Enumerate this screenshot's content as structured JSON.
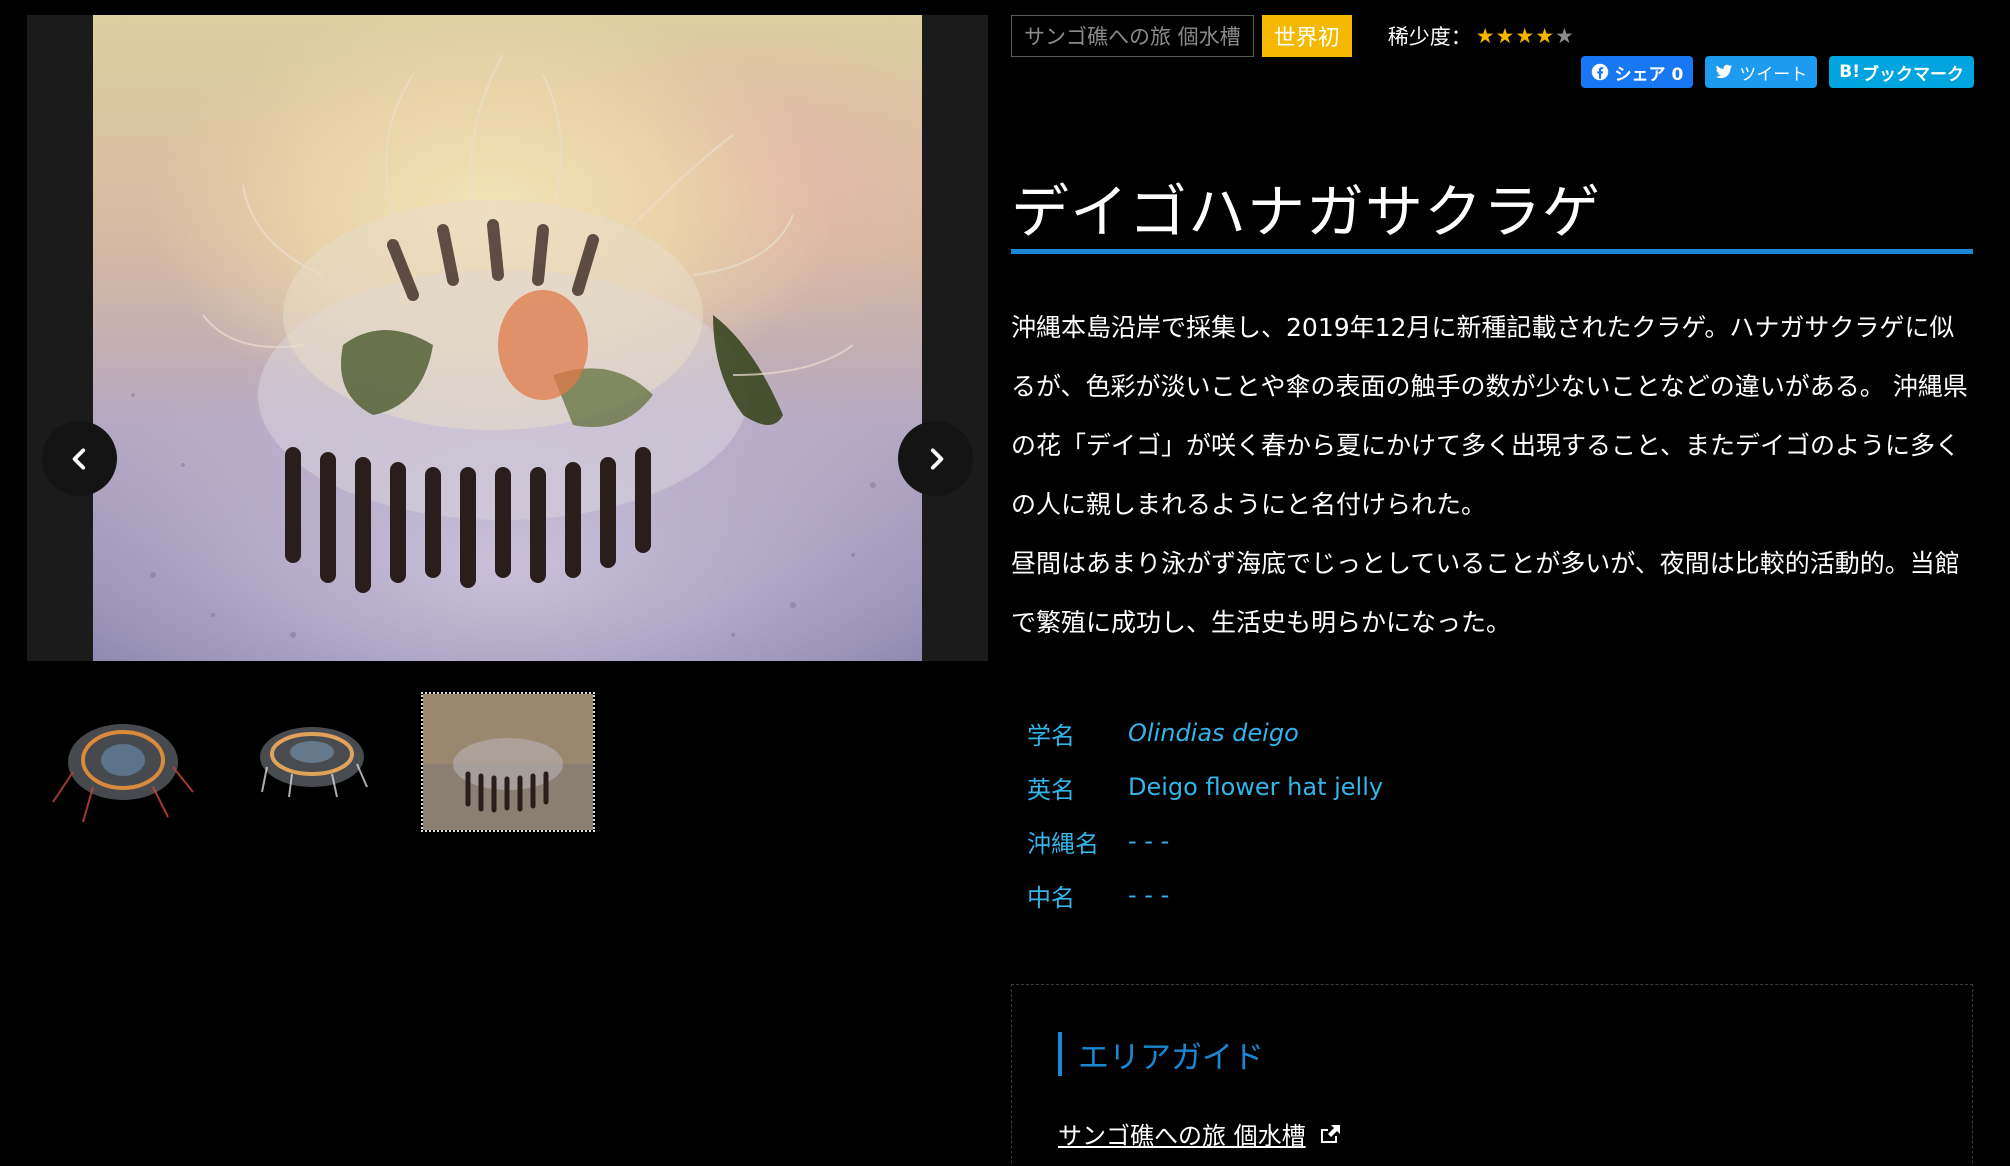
{
  "gallery": {
    "main_image_alt": "",
    "prev_label": "‹",
    "next_label": "›"
  },
  "tags": {
    "location": "サンゴ礁への旅 個水槽",
    "world_first": "世界初"
  },
  "rarity": {
    "label": "稀少度：",
    "stars_filled": 4,
    "stars_total": 5
  },
  "share": {
    "facebook": "シェア 0",
    "twitter": "ツイート",
    "hatena": "ブックマーク",
    "hatena_prefix": "B!"
  },
  "title": "デイゴハナガサクラゲ",
  "description": [
    "沖縄本島沿岸で採集し、2019年12月に新種記載されたクラゲ。ハナガサクラゲに似るが、色彩が淡いことや傘の表面の触手の数が少ないことなどの違いがある。 沖縄県の花「デイゴ」が咲く春から夏にかけて多く出現すること、またデイゴのように多くの人に親しまれるようにと名付けられた。",
    "昼間はあまり泳がず海底でじっとしていることが多いが、夜間は比較的活動的。当館で繁殖に成功し、生活史も明らかになった。"
  ],
  "facts": [
    {
      "key": "学名",
      "value": "Olindias deigo"
    },
    {
      "key": "英名",
      "value": "Deigo flower hat jelly"
    },
    {
      "key": "沖縄名",
      "value": "- - -"
    },
    {
      "key": "中名",
      "value": "- - -"
    }
  ],
  "area_guide": {
    "heading": "エリアガイド",
    "link": "サンゴ礁への旅 個水槽"
  },
  "colors": {
    "accent_blue": "#1a87d3",
    "fact_cyan": "#34b5ea",
    "badge_yellow": "#f5b800",
    "star": "#f7b500"
  }
}
